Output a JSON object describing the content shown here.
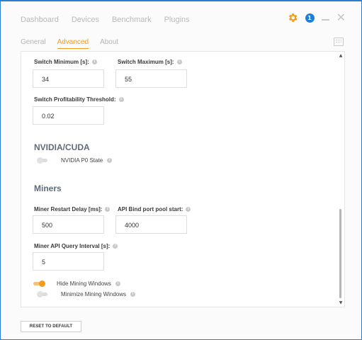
{
  "topnav": {
    "items": [
      "Dashboard",
      "Devices",
      "Benchmark",
      "Plugins"
    ]
  },
  "window_controls": {
    "notification_count": "1"
  },
  "subtabs": {
    "items": [
      "General",
      "Advanced",
      "About"
    ],
    "active": "Advanced"
  },
  "fields": {
    "switch_min": {
      "label": "Switch Minimum [s]:",
      "value": "34"
    },
    "switch_max": {
      "label": "Switch Maximum [s]:",
      "value": "55"
    },
    "switch_profit": {
      "label": "Switch Profitability Threshold:",
      "value": "0.02"
    },
    "restart_delay": {
      "label": "Miner Restart Delay [ms]:",
      "value": "500"
    },
    "api_bind": {
      "label": "API Bind port pool start:",
      "value": "4000"
    },
    "api_query": {
      "label": "Miner API Query Interval [s]:",
      "value": "5"
    }
  },
  "sections": {
    "nvidia": "NVIDIA/CUDA",
    "miners": "Miners"
  },
  "toggles": {
    "nvidia_p0": {
      "label": "NVIDIA P0 State",
      "on": false
    },
    "hide_mining": {
      "label": "Hide Mining Windows",
      "on": true
    },
    "minimize_mining": {
      "label": "Minimize Mining Windows",
      "on": false
    }
  },
  "footer": {
    "reset_label": "RESET TO DEFAULT"
  },
  "colors": {
    "accent": "#f39c1e",
    "badge": "#1e7fd6",
    "window_border": "#2a7fd4"
  },
  "icons": [
    "gear-icon",
    "notification-badge",
    "minimize-icon",
    "close-icon",
    "panel-icon",
    "info-icon",
    "scroll-up-icon",
    "scroll-down-icon"
  ]
}
